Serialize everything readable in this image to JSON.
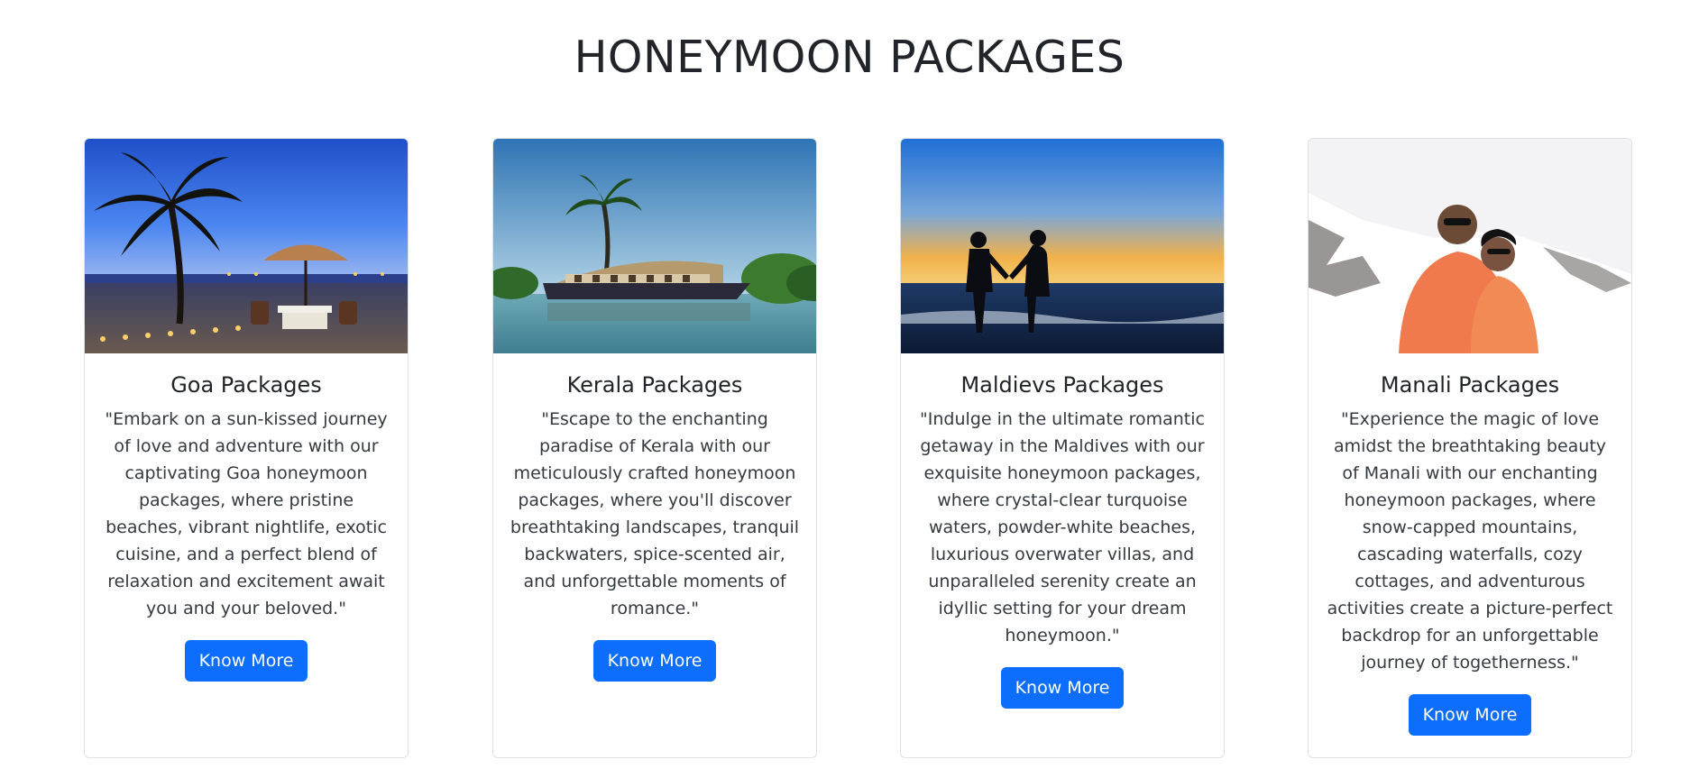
{
  "heading": "HONEYMOON PACKAGES",
  "accent_color": "#0d6efd",
  "cards": [
    {
      "title": "Goa Packages",
      "text": "\"Embark on a sun-kissed journey of love and adventure with our captivating Goa honeymoon packages, where pristine beaches, vibrant nightlife, exotic cuisine, and a perfect blend of relaxation and excitement await you and your beloved.\"",
      "button": "Know More",
      "image": "beach-dinner-sunset-photo"
    },
    {
      "title": "Kerala Packages",
      "text": "\"Escape to the enchanting paradise of Kerala with our meticulously crafted honeymoon packages, where you'll discover breathtaking landscapes, tranquil backwaters, spice-scented air, and unforgettable moments of romance.\"",
      "button": "Know More",
      "image": "houseboat-backwaters-photo"
    },
    {
      "title": "Maldievs Packages",
      "text": "\"Indulge in the ultimate romantic getaway in the Maldives with our exquisite honeymoon packages, where crystal-clear turquoise waters, powder-white beaches, luxurious overwater villas, and unparalleled serenity create an idyllic setting for your dream honeymoon.\"",
      "button": "Know More",
      "image": "couple-beach-silhouette-photo"
    },
    {
      "title": "Manali Packages",
      "text": "\"Experience the magic of love amidst the breathtaking beauty of Manali with our enchanting honeymoon packages, where snow-capped mountains, cascading waterfalls, cozy cottages, and adventurous activities create a picture-perfect backdrop for an unforgettable journey of togetherness.\"",
      "button": "Know More",
      "image": "couple-snow-mountains-photo"
    }
  ]
}
